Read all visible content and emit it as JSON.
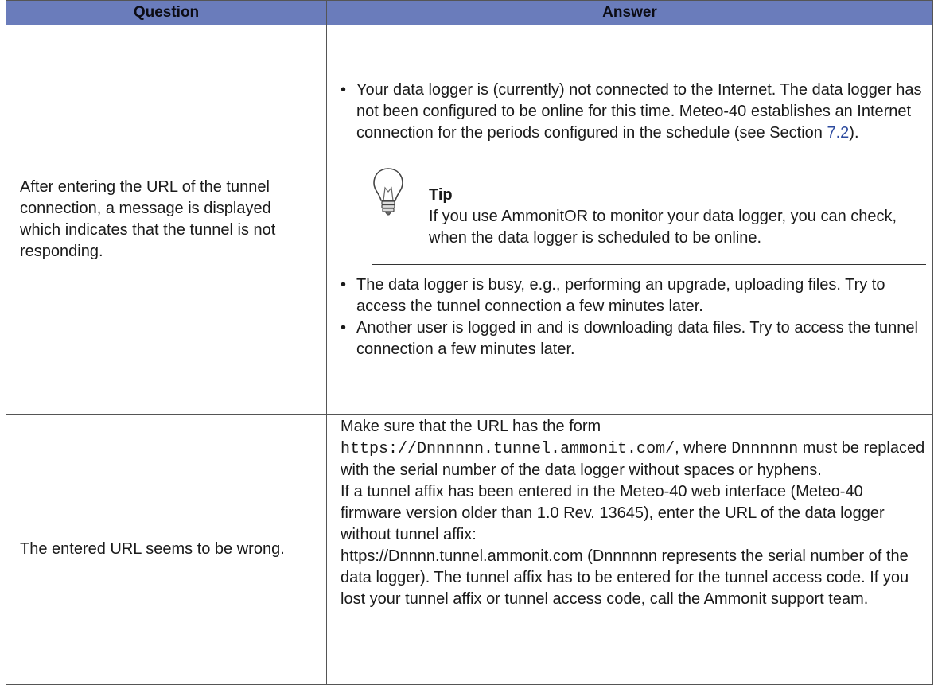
{
  "table": {
    "header_question": "Question",
    "header_answer": "Answer"
  },
  "row1": {
    "question": "After entering the URL of the tunnel connection, a message is displayed which indicates that the tunnel is not responding.",
    "bullet1_pre": "Your data logger is (currently) not connected to the Internet. The data logger has not been configured to be online for this time. Meteo-40 establishes an Internet connection for the periods configured in the schedule (see Section ",
    "bullet1_link": "7.2",
    "bullet1_post": ").",
    "tip_title": "Tip",
    "tip_text": "If you use AmmonitOR to monitor your data logger, you can check, when the data logger is scheduled to be online.",
    "bullet2": "The data logger is busy, e.g., performing an upgrade, uploading files. Try to access the tunnel connection a few minutes later.",
    "bullet3": "Another user is logged in and is downloading data files. Try to access the tunnel connection a few minutes later."
  },
  "row2": {
    "question": "The entered URL seems to be wrong.",
    "intro": "Make sure that the URL has the form",
    "url_form": "https://Dnnnnnn.tunnel.ammonit.com/",
    "mid1": ", where ",
    "serial_placeholder": "Dnnnnnn",
    "mid2": " must be replaced with the serial number of the data logger without spaces or hyphens.",
    "para2": "If a tunnel affix has been entered in the Meteo-40 web interface (Meteo-40 firmware version older than 1.0 Rev. 13645), enter the URL of the data logger without tunnel affix:",
    "para3": "https://Dnnnn.tunnel.ammonit.com (Dnnnnnn represents the serial number of the data logger). The tunnel affix has to be entered for the tunnel access code. If you lost your tunnel affix or tunnel access code, call the Ammonit support team."
  }
}
